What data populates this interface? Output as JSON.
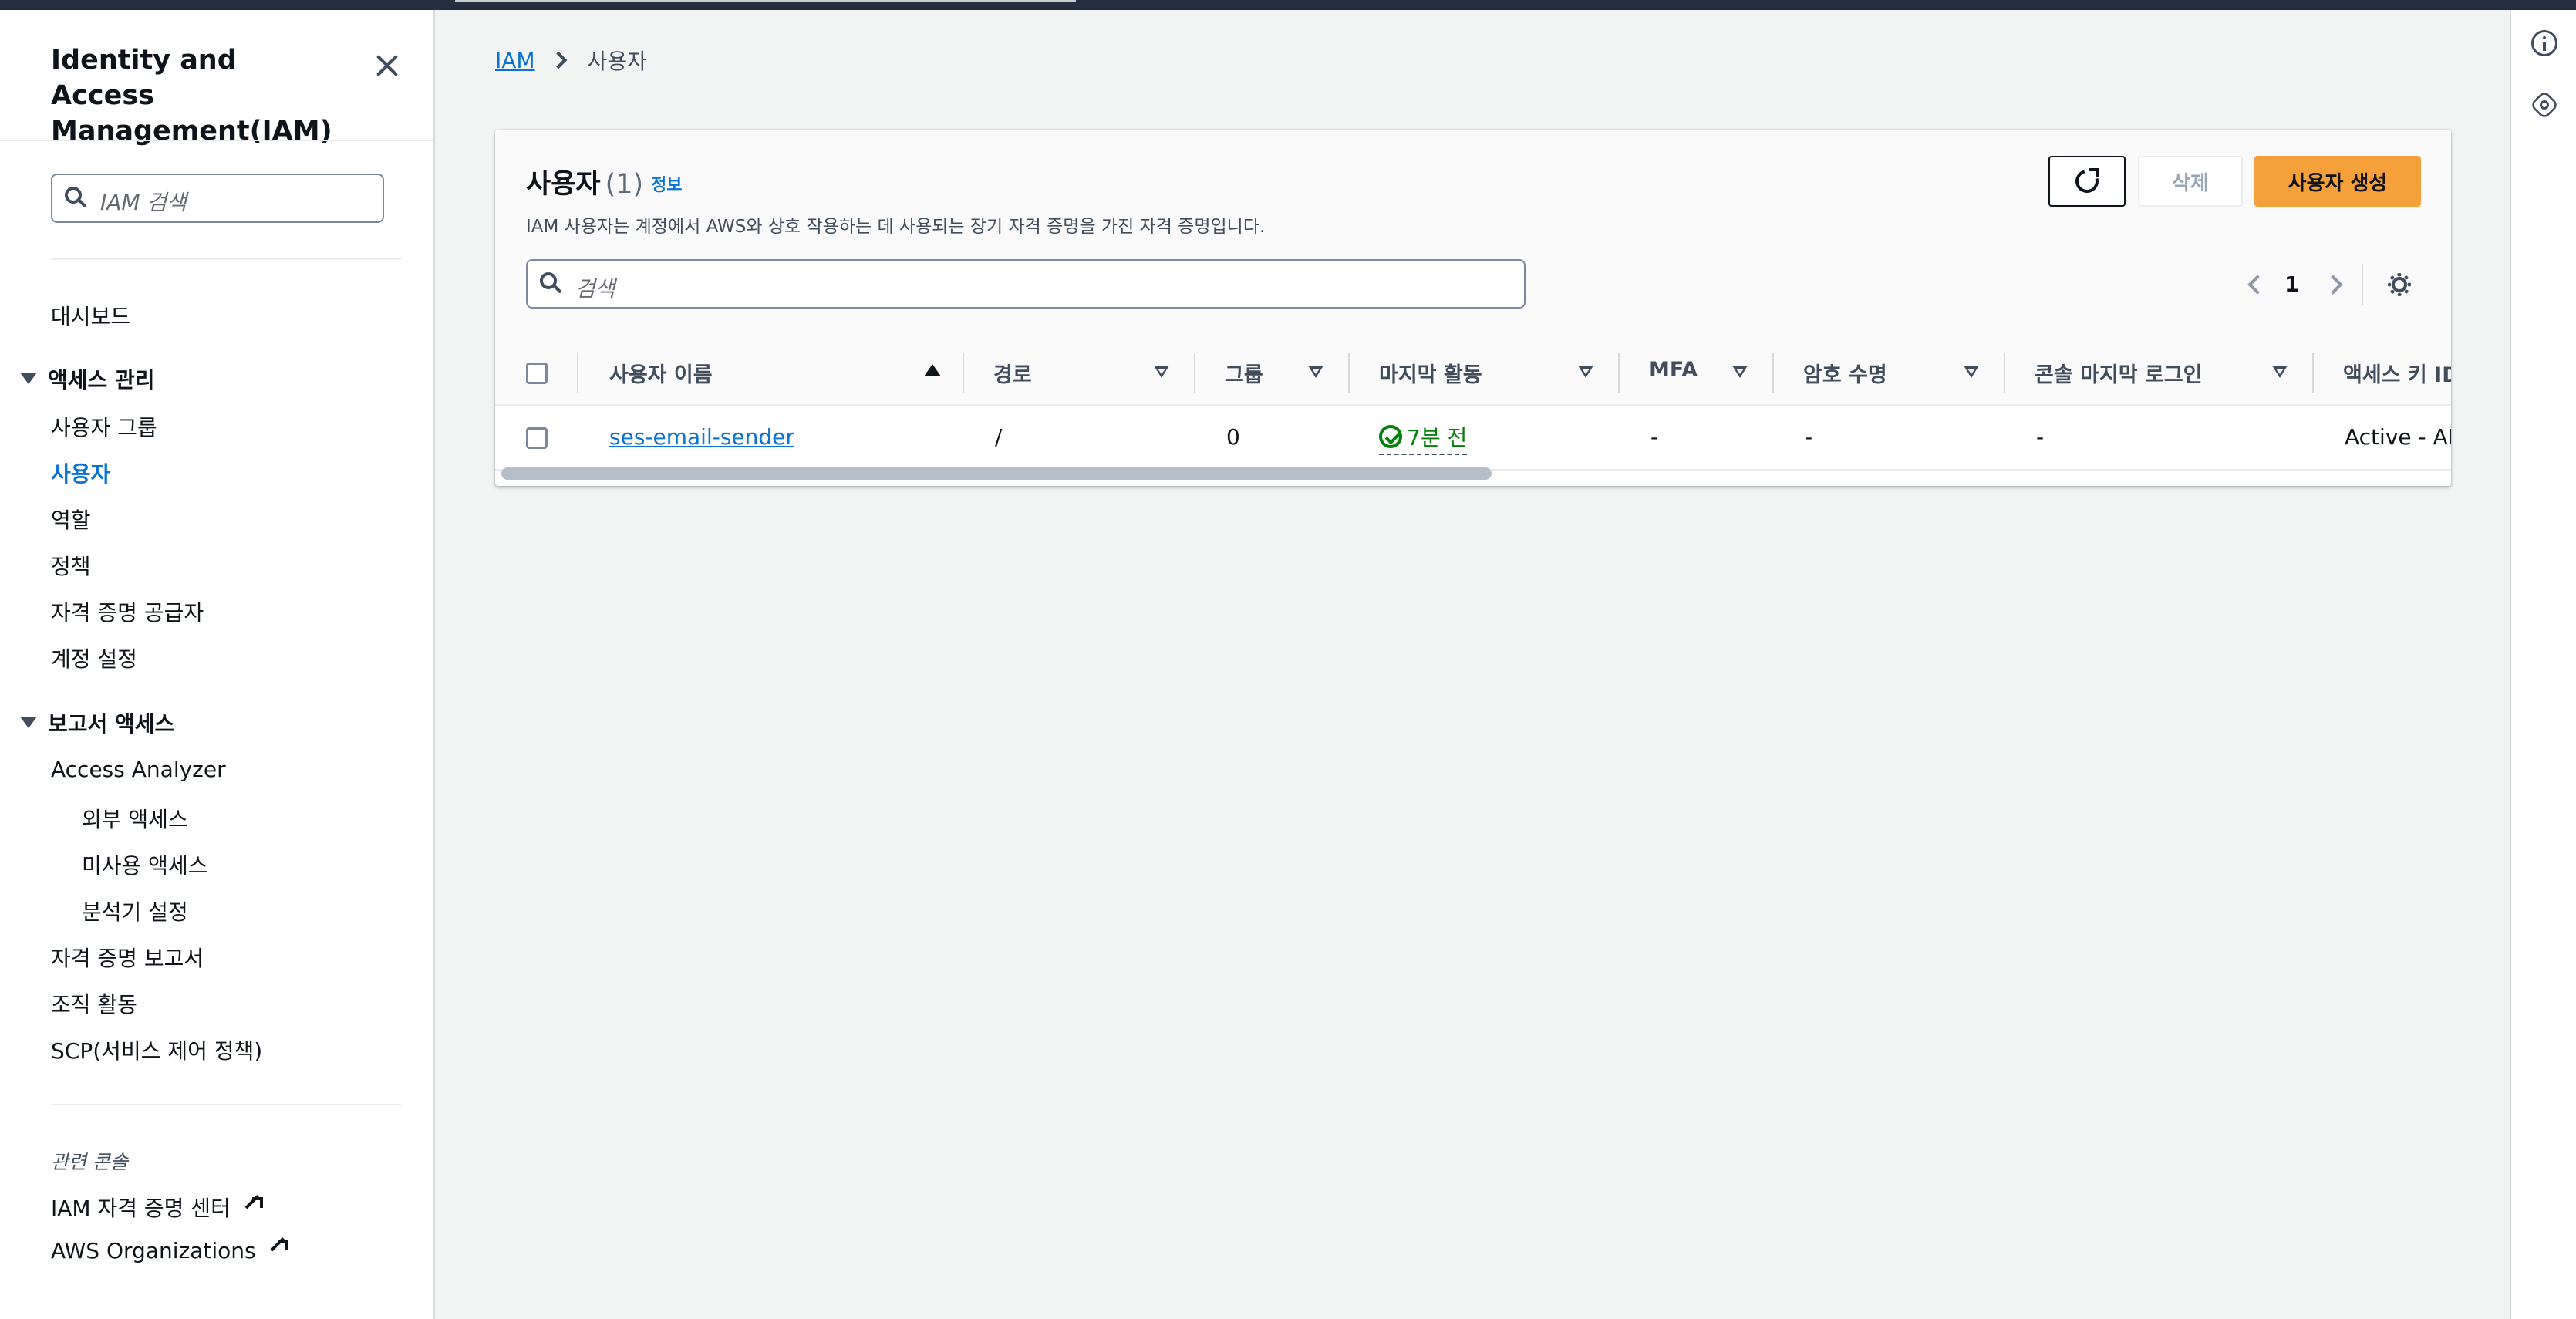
{
  "sidebar": {
    "title": "Identity and Access Management(IAM)",
    "search_placeholder": "IAM 검색",
    "dashboard": "대시보드",
    "access_mgmt": {
      "heading": "액세스 관리",
      "items": [
        "사용자 그룹",
        "사용자",
        "역할",
        "정책",
        "자격 증명 공급자",
        "계정 설정"
      ],
      "active": "사용자"
    },
    "reports": {
      "heading": "보고서 액세스",
      "access_analyzer": "Access Analyzer",
      "analyzer_items": [
        "외부 액세스",
        "미사용 액세스",
        "분석기 설정"
      ],
      "items": [
        "자격 증명 보고서",
        "조직 활동",
        "SCP(서비스 제어 정책)"
      ]
    },
    "related": {
      "heading": "관련 콘솔",
      "links": [
        "IAM 자격 증명 센터",
        "AWS Organizations"
      ]
    }
  },
  "breadcrumb": {
    "root": "IAM",
    "current": "사용자"
  },
  "panel": {
    "title": "사용자",
    "count": "(1)",
    "info": "정보",
    "description": "IAM 사용자는 계정에서 AWS와 상호 작용하는 데 사용되는 장기 자격 증명을 가진 자격 증명입니다.",
    "delete_label": "삭제",
    "create_label": "사용자 생성",
    "search_placeholder": "검색",
    "page": "1"
  },
  "table": {
    "columns": [
      "사용자 이름",
      "경로",
      "그룹",
      "마지막 활동",
      "MFA",
      "암호 수명",
      "콘솔 마지막 로그인",
      "액세스 키 ID"
    ],
    "rows": [
      {
        "name": "ses-email-sender",
        "path": "/",
        "groups": "0",
        "last_activity": "7분 전",
        "mfa": "-",
        "password_age": "-",
        "console_last_signin": "-",
        "access_key": "Active - AK"
      }
    ]
  }
}
